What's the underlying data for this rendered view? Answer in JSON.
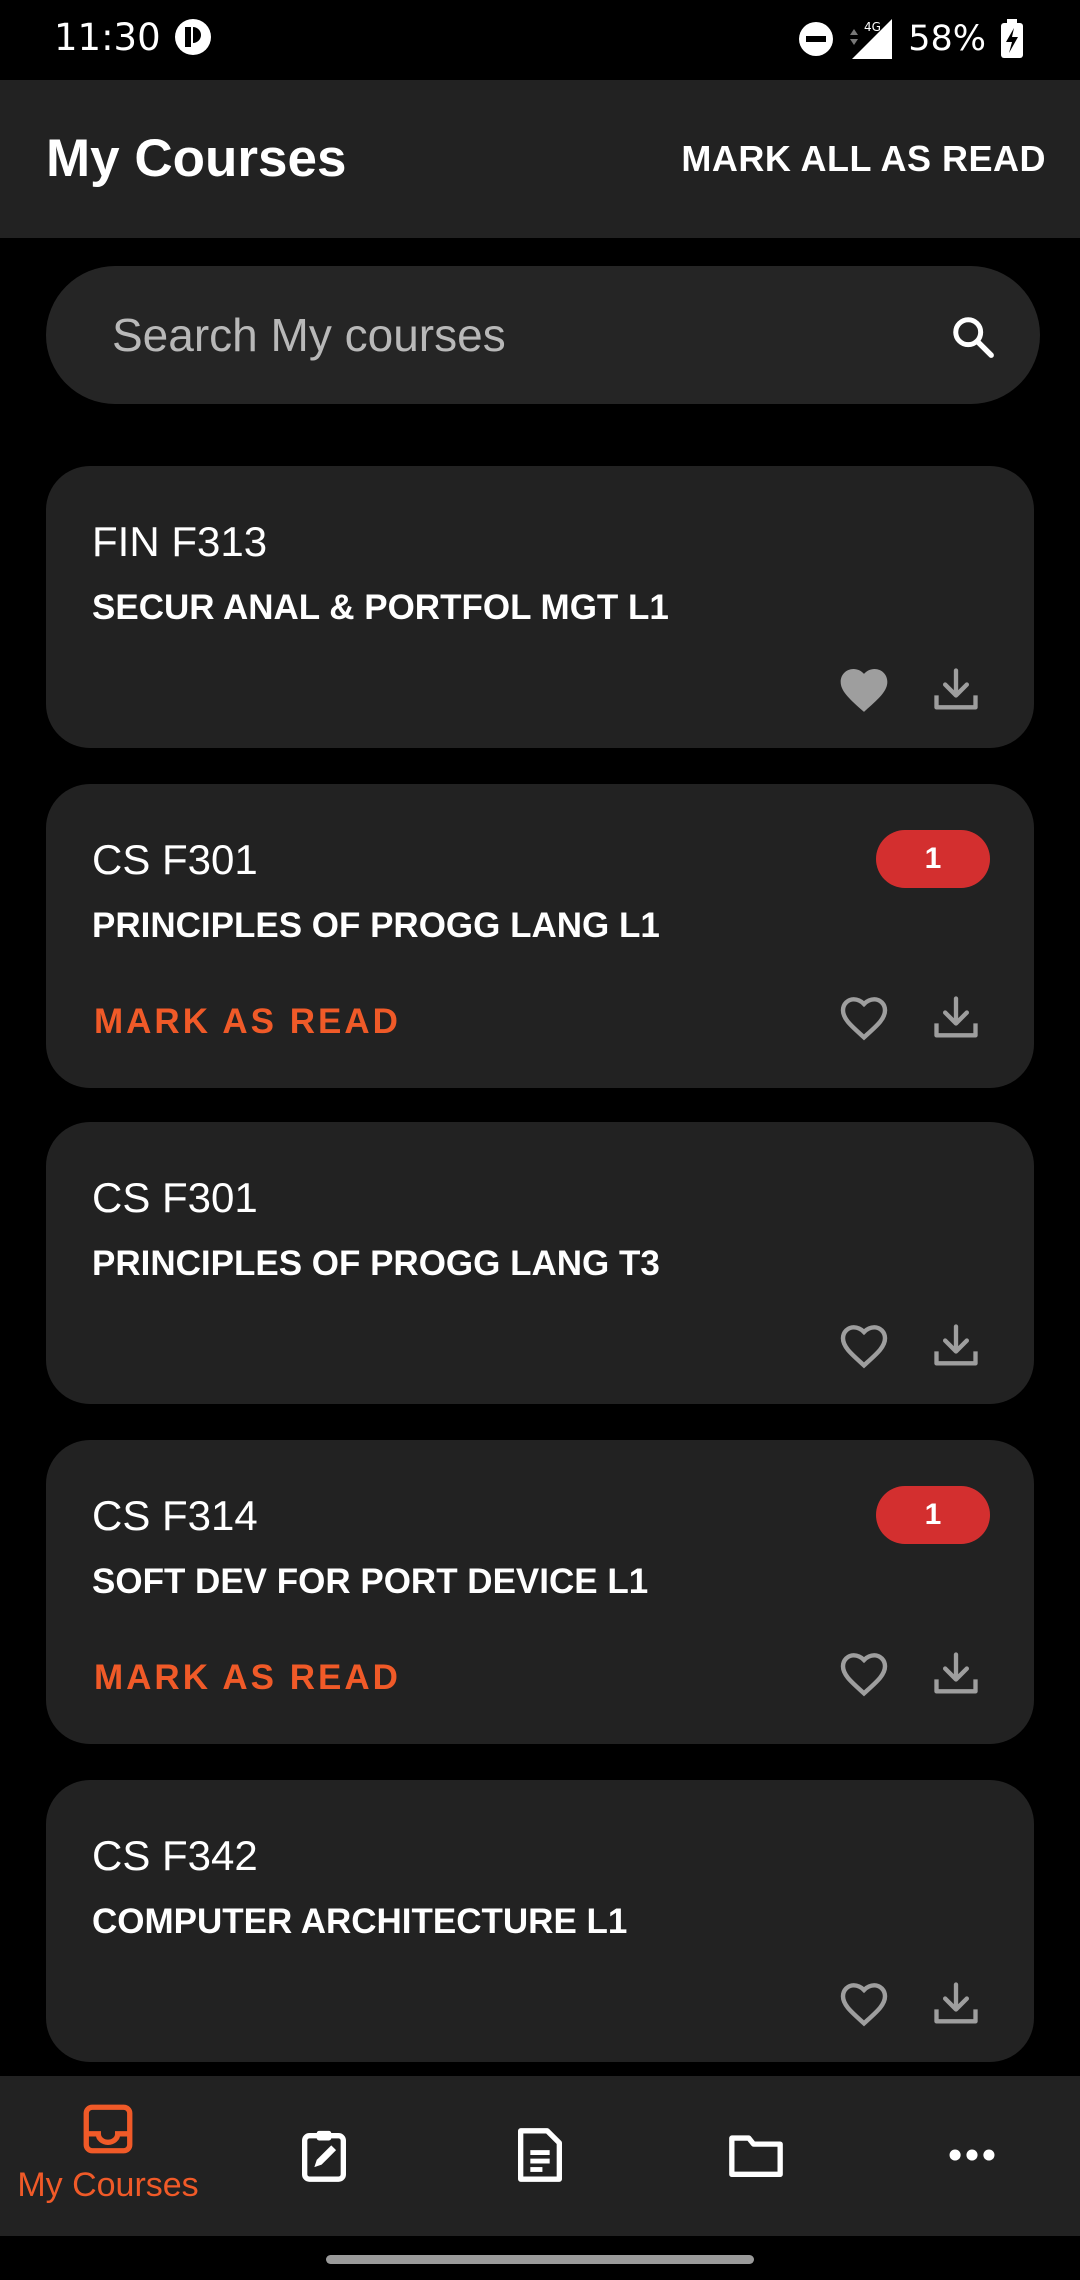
{
  "status_bar": {
    "time": "11:30",
    "network": "4G",
    "battery": "58%"
  },
  "appbar": {
    "title": "My Courses",
    "action": "MARK ALL AS READ"
  },
  "search": {
    "placeholder": "Search My courses"
  },
  "courses": [
    {
      "code": "FIN F313",
      "name": "SECUR ANAL & PORTFOL MGT L1",
      "badge": "",
      "mark_label": "",
      "favorite": true
    },
    {
      "code": "CS F301",
      "name": "PRINCIPLES OF PROGG LANG L1",
      "badge": "1",
      "mark_label": "MARK AS READ",
      "favorite": false
    },
    {
      "code": "CS F301",
      "name": "PRINCIPLES OF PROGG LANG T3",
      "badge": "",
      "mark_label": "",
      "favorite": false
    },
    {
      "code": "CS F314",
      "name": "SOFT DEV FOR PORT DEVICE L1",
      "badge": "1",
      "mark_label": "MARK AS READ",
      "favorite": false
    },
    {
      "code": "CS F342",
      "name": "COMPUTER ARCHITECTURE L1",
      "badge": "",
      "mark_label": "",
      "favorite": false
    }
  ],
  "bottom_nav": {
    "items": [
      {
        "icon": "inbox-icon",
        "label": "My Courses",
        "active": true
      },
      {
        "icon": "assignment-icon",
        "label": "",
        "active": false
      },
      {
        "icon": "document-icon",
        "label": "",
        "active": false
      },
      {
        "icon": "folder-icon",
        "label": "",
        "active": false
      },
      {
        "icon": "more-icon",
        "label": "",
        "active": false
      }
    ]
  },
  "colors": {
    "accent": "#f05a28",
    "badge": "#d32f2f",
    "surface": "#222222",
    "background": "#000000"
  }
}
